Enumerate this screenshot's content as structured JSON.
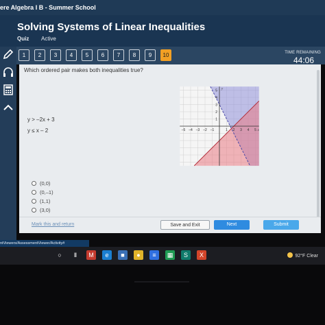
{
  "window": {
    "title": "ere Algebra I B - Summer School"
  },
  "header": {
    "title": "Solving Systems of Linear Inequalities",
    "quiz_label": "Quiz",
    "status": "Active"
  },
  "nav": {
    "questions": [
      "1",
      "2",
      "3",
      "4",
      "5",
      "6",
      "7",
      "8",
      "9",
      "10"
    ],
    "active_question": "10",
    "time_label": "TIME REMAINING",
    "time_value": "44:06"
  },
  "tools": [
    "pencil-icon",
    "headphones-icon",
    "calculator-icon",
    "collapse-icon"
  ],
  "question": {
    "prompt": "Which ordered pair makes both inequalities true?",
    "inequality_1": "y > –2x + 3",
    "inequality_2": "y ≤ x – 2",
    "options": [
      "(0,0)",
      "(0,–1)",
      "(1,1)",
      "(3,0)"
    ]
  },
  "graph": {
    "x_ticks": [
      "–5",
      "–4",
      "–3",
      "–2",
      "–1",
      "1",
      "2",
      "3",
      "4",
      "5"
    ],
    "y_ticks": [
      "5",
      "4",
      "3",
      "2",
      "1"
    ],
    "x_label": "x",
    "y_label": "y",
    "colors": {
      "region_1": "#8f8fd9",
      "region_2": "#e97a84",
      "overlap": "#b8578f"
    }
  },
  "actions": {
    "mark_label": "Mark this and return",
    "save_label": "Save and Exit",
    "next_label": "Next",
    "submit_label": "Submit"
  },
  "status_url": "ntViewers/AssessmentViewer/Activity#",
  "taskbar": {
    "apps": [
      "windows-search-icon",
      "task-view-icon",
      "gmail-icon",
      "edge-icon",
      "store-icon",
      "chrome-icon",
      "docs-icon",
      "sheets-icon",
      "sway-icon",
      "excel-icon"
    ],
    "weather": "92°F  Clear"
  },
  "colors": {
    "header": "#1a3552",
    "active_question": "#f2a024",
    "next_button": "#2f8be0"
  }
}
